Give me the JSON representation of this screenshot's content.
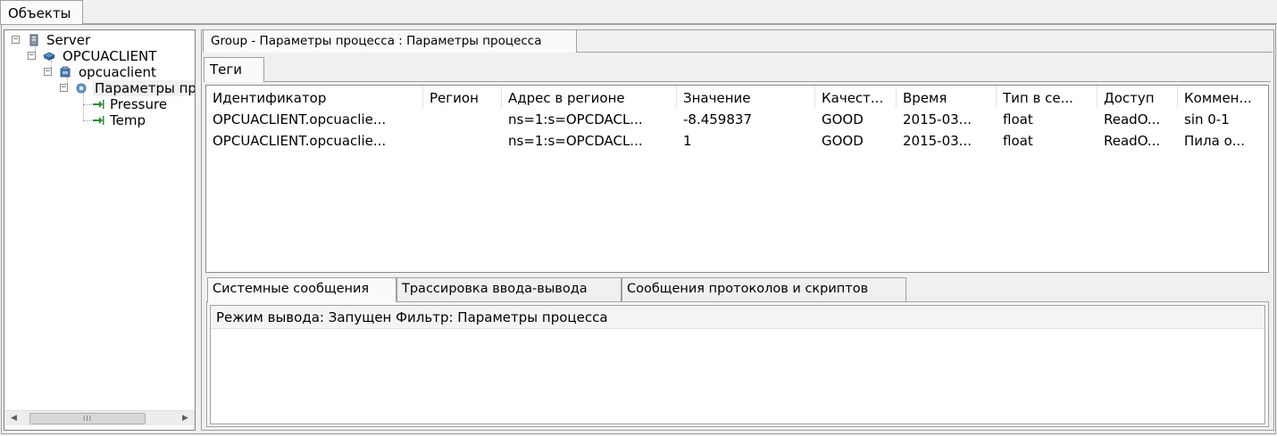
{
  "window": {
    "objects_tab": "Объекты"
  },
  "tree": {
    "nodes": [
      {
        "label": "Server",
        "icon": "server-icon",
        "expander": "−"
      },
      {
        "label": "OPCUACLIENT",
        "icon": "driver-icon",
        "expander": "−"
      },
      {
        "label": "opcuaclient",
        "icon": "device-icon",
        "expander": "−"
      },
      {
        "label": "Параметры пр",
        "icon": "group-icon",
        "expander": "−"
      },
      {
        "label": "Pressure",
        "icon": "tag-arrow-icon"
      },
      {
        "label": "Temp",
        "icon": "tag-arrow-icon"
      }
    ],
    "scrollbar": {
      "left_arrow": "◀",
      "right_arrow": "▶",
      "thumb_grip": "III"
    }
  },
  "main": {
    "group_tab": "Group - Параметры процесса : Параметры процесса",
    "tags_tab": "Теги",
    "table": {
      "columns": [
        "Идентификатор",
        "Регион",
        "Адрес в регионе",
        "Значение",
        "Качест...",
        "Время",
        "Тип в се...",
        "Доступ",
        "Коммен..."
      ],
      "rows": [
        [
          "OPCUACLIENT.opcuaclie...",
          "",
          "ns=1:s=OPCDACL...",
          "-8.459837",
          "GOOD",
          "2015-03...",
          "float",
          "ReadO...",
          "sin 0-1"
        ],
        [
          "OPCUACLIENT.opcuaclie...",
          "",
          "ns=1:s=OPCDACL...",
          "1",
          "GOOD",
          "2015-03...",
          "float",
          "ReadO...",
          "Пила о..."
        ]
      ]
    },
    "bottom_tabs": [
      "Системные сообщения",
      "Трассировка ввода-вывода",
      "Сообщения протоколов и скриптов"
    ],
    "log_line": "Режим вывода: Запущен Фильтр: Параметры процесса"
  },
  "colors": {
    "selection": "#f0f0f0",
    "border": "#a0a0a0",
    "tag_arrow": "#2e8b2e",
    "icon_blue": "#3a6ea5"
  }
}
